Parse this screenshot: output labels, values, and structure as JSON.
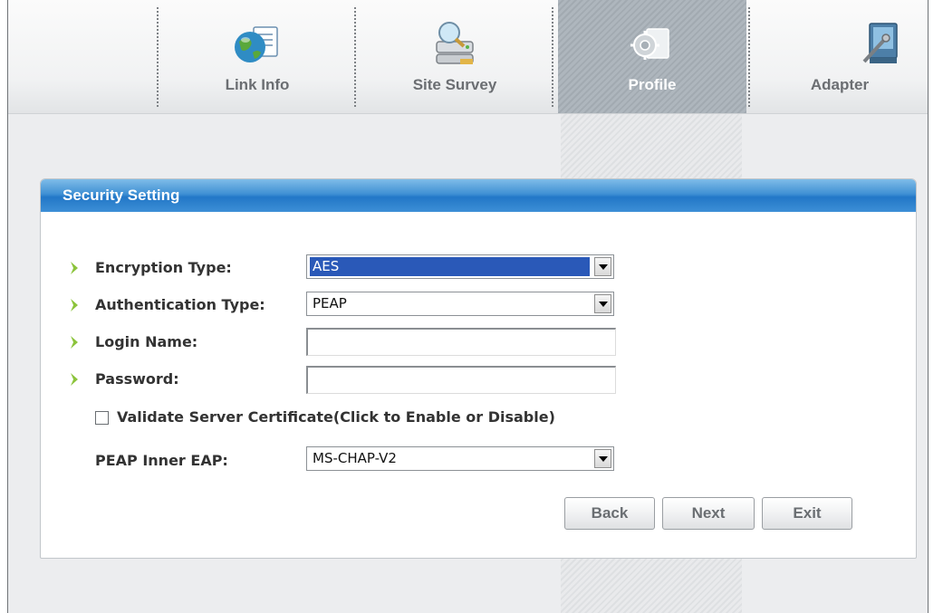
{
  "nav": {
    "tabs": [
      {
        "label": "Link Info",
        "icon": "globe-document-icon",
        "active": false
      },
      {
        "label": "Site Survey",
        "icon": "network-search-icon",
        "active": false
      },
      {
        "label": "Profile",
        "icon": "gear-document-icon",
        "active": true
      },
      {
        "label": "Adapter",
        "icon": "adapter-card-icon",
        "active": false
      }
    ]
  },
  "panel": {
    "title": "Security Setting",
    "fields": {
      "encryption_type": {
        "label": "Encryption Type:",
        "value": "AES"
      },
      "authentication_type": {
        "label": "Authentication Type:",
        "value": "PEAP"
      },
      "login_name": {
        "label": "Login Name:",
        "value": ""
      },
      "password": {
        "label": "Password:",
        "value": ""
      },
      "validate_cert": {
        "label": "Validate Server Certificate(Click to Enable or Disable)",
        "checked": false
      },
      "peap_inner_eap": {
        "label": "PEAP Inner EAP:",
        "value": "MS-CHAP-V2"
      }
    },
    "buttons": {
      "back": "Back",
      "next": "Next",
      "exit": "Exit"
    }
  },
  "colors": {
    "header_blue": "#2277c7",
    "selection_blue": "#2a59b8",
    "bullet_green": "#8cc43c",
    "active_tab": "#a8b0b7"
  }
}
